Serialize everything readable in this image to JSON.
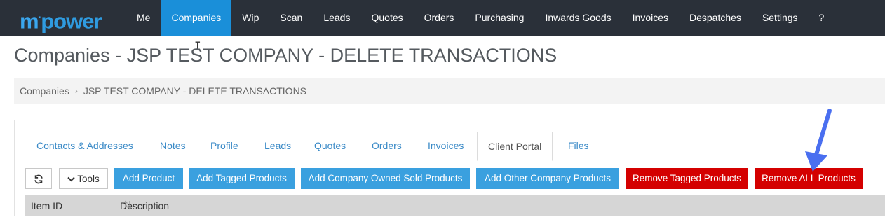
{
  "logo": {
    "text": "mpower"
  },
  "nav": {
    "items": [
      "Me",
      "Companies",
      "Wip",
      "Scan",
      "Leads",
      "Quotes",
      "Orders",
      "Purchasing",
      "Inwards Goods",
      "Invoices",
      "Despatches",
      "Settings",
      "?"
    ],
    "active": "Companies"
  },
  "page": {
    "title": "Companies - JSP TEST COMPANY - DELETE TRANSACTIONS"
  },
  "breadcrumb": {
    "root": "Companies",
    "current": "JSP TEST COMPANY - DELETE TRANSACTIONS"
  },
  "tabs": {
    "items": [
      "Contacts & Addresses",
      "Notes",
      "Profile",
      "Leads",
      "Quotes",
      "Orders",
      "Invoices",
      "Client Portal",
      "Files"
    ],
    "active": "Client Portal"
  },
  "toolbar": {
    "tools_label": "Tools",
    "buttons": [
      "Add Product",
      "Add Tagged Products",
      "Add Company Owned Sold Products",
      "Add Other Company Products",
      "Remove Tagged Products",
      "Remove ALL Products"
    ]
  },
  "table": {
    "columns": [
      "Item ID",
      "Description"
    ]
  },
  "colors": {
    "nav_bg": "#2a3039",
    "active": "#1a8fd9",
    "primary_button": "#3aa0df",
    "danger_button": "#d40000",
    "annotation_arrow": "#4a6ff0"
  }
}
